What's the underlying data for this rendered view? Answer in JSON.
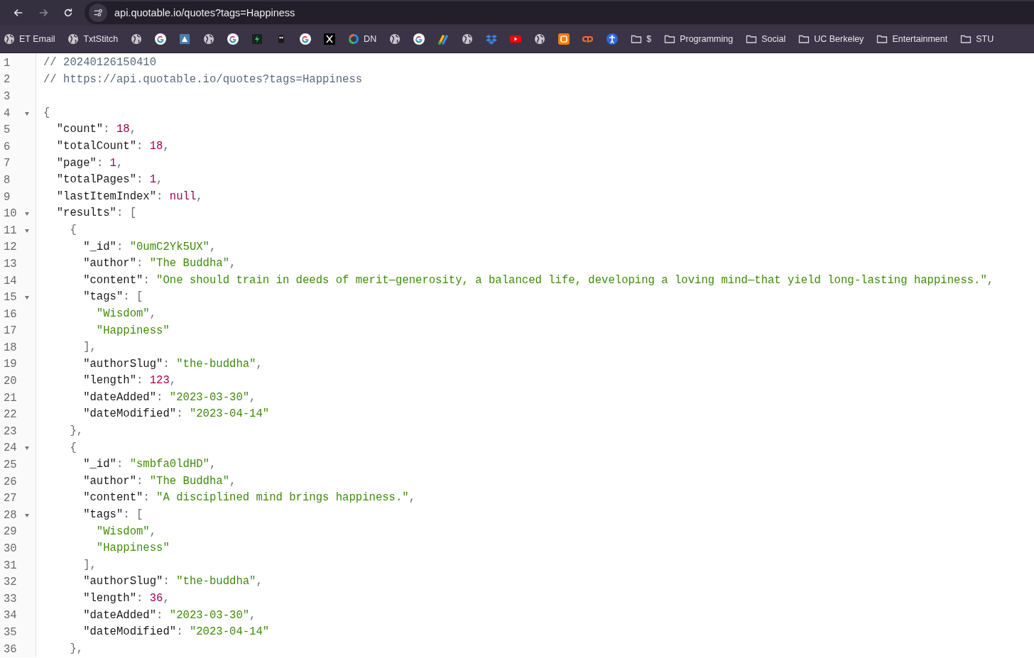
{
  "toolbar": {
    "nav": [
      {
        "kind": "back",
        "disabled": false
      },
      {
        "kind": "forward",
        "disabled": true
      },
      {
        "kind": "reload",
        "disabled": false
      }
    ],
    "url": "api.quotable.io/quotes?tags=Happiness"
  },
  "bookmarks": [
    {
      "kind": "globe",
      "label": "ET Email"
    },
    {
      "kind": "globe",
      "label": "TxtStitch"
    },
    {
      "kind": "globe"
    },
    {
      "kind": "google"
    },
    {
      "kind": "app"
    },
    {
      "kind": "globe"
    },
    {
      "kind": "google"
    },
    {
      "kind": "bolt"
    },
    {
      "kind": "ghost"
    },
    {
      "kind": "google"
    },
    {
      "kind": "x"
    },
    {
      "kind": "ring",
      "label": "DN"
    },
    {
      "kind": "globe"
    },
    {
      "kind": "google"
    },
    {
      "kind": "ads"
    },
    {
      "kind": "globe"
    },
    {
      "kind": "dropbox"
    },
    {
      "kind": "video"
    },
    {
      "kind": "globe"
    },
    {
      "kind": "blogger"
    },
    {
      "kind": "cp"
    },
    {
      "kind": "person"
    },
    {
      "kind": "folder",
      "label": "$"
    },
    {
      "kind": "folder",
      "label": "Programming"
    },
    {
      "kind": "folder",
      "label": "Social"
    },
    {
      "kind": "folder",
      "label": "UC Berkeley"
    },
    {
      "kind": "folder",
      "label": "Entertainment"
    },
    {
      "kind": "folder",
      "label": "STU"
    }
  ],
  "code_lines": [
    {
      "number": "1",
      "foldable": false,
      "tokens": [
        {
          "kind": "comment",
          "text": "// 20240126150410"
        }
      ]
    },
    {
      "number": "2",
      "foldable": false,
      "tokens": [
        {
          "kind": "comment",
          "text": "// https://api.quotable.io/quotes?tags=Happiness"
        }
      ]
    },
    {
      "number": "3",
      "foldable": false
    },
    {
      "number": "4",
      "foldable": true,
      "tokens": [
        {
          "kind": "punct",
          "text": "{"
        }
      ]
    },
    {
      "number": "5",
      "foldable": false,
      "tokens": [
        {
          "kind": "key",
          "text": "  \"count\""
        },
        {
          "kind": "punct",
          "text": ": "
        },
        {
          "kind": "number",
          "text": "18"
        },
        {
          "kind": "punct",
          "text": ","
        }
      ]
    },
    {
      "number": "6",
      "foldable": false,
      "tokens": [
        {
          "kind": "key",
          "text": "  \"totalCount\""
        },
        {
          "kind": "punct",
          "text": ": "
        },
        {
          "kind": "number",
          "text": "18"
        },
        {
          "kind": "punct",
          "text": ","
        }
      ]
    },
    {
      "number": "7",
      "foldable": false,
      "tokens": [
        {
          "kind": "key",
          "text": "  \"page\""
        },
        {
          "kind": "punct",
          "text": ": "
        },
        {
          "kind": "number",
          "text": "1"
        },
        {
          "kind": "punct",
          "text": ","
        }
      ]
    },
    {
      "number": "8",
      "foldable": false,
      "tokens": [
        {
          "kind": "key",
          "text": "  \"totalPages\""
        },
        {
          "kind": "punct",
          "text": ": "
        },
        {
          "kind": "number",
          "text": "1"
        },
        {
          "kind": "punct",
          "text": ","
        }
      ]
    },
    {
      "number": "9",
      "foldable": false,
      "tokens": [
        {
          "kind": "key",
          "text": "  \"lastItemIndex\""
        },
        {
          "kind": "punct",
          "text": ": "
        },
        {
          "kind": "null",
          "text": "null"
        },
        {
          "kind": "punct",
          "text": ","
        }
      ]
    },
    {
      "number": "10",
      "foldable": true,
      "tokens": [
        {
          "kind": "key",
          "text": "  \"results\""
        },
        {
          "kind": "punct",
          "text": ": ["
        }
      ]
    },
    {
      "number": "11",
      "foldable": true,
      "tokens": [
        {
          "kind": "punct",
          "text": "    {"
        }
      ]
    },
    {
      "number": "12",
      "foldable": false,
      "tokens": [
        {
          "kind": "key",
          "text": "      \"_id\""
        },
        {
          "kind": "punct",
          "text": ": "
        },
        {
          "kind": "string",
          "text": "\"0umC2Yk5UX\""
        },
        {
          "kind": "punct",
          "text": ","
        }
      ]
    },
    {
      "number": "13",
      "foldable": false,
      "tokens": [
        {
          "kind": "key",
          "text": "      \"author\""
        },
        {
          "kind": "punct",
          "text": ": "
        },
        {
          "kind": "string",
          "text": "\"The Buddha\""
        },
        {
          "kind": "punct",
          "text": ","
        }
      ]
    },
    {
      "number": "14",
      "foldable": false,
      "tokens": [
        {
          "kind": "key",
          "text": "      \"content\""
        },
        {
          "kind": "punct",
          "text": ": "
        },
        {
          "kind": "string",
          "text": "\"One should train in deeds of merit—generosity, a balanced life, developing a loving mind—that yield long-lasting happiness.\""
        },
        {
          "kind": "punct",
          "text": ","
        }
      ]
    },
    {
      "number": "15",
      "foldable": true,
      "tokens": [
        {
          "kind": "key",
          "text": "      \"tags\""
        },
        {
          "kind": "punct",
          "text": ": ["
        }
      ]
    },
    {
      "number": "16",
      "foldable": false,
      "tokens": [
        {
          "kind": "string",
          "text": "        \"Wisdom\""
        },
        {
          "kind": "punct",
          "text": ","
        }
      ]
    },
    {
      "number": "17",
      "foldable": false,
      "tokens": [
        {
          "kind": "string",
          "text": "        \"Happiness\""
        }
      ]
    },
    {
      "number": "18",
      "foldable": false,
      "tokens": [
        {
          "kind": "punct",
          "text": "      ],"
        }
      ]
    },
    {
      "number": "19",
      "foldable": false,
      "tokens": [
        {
          "kind": "key",
          "text": "      \"authorSlug\""
        },
        {
          "kind": "punct",
          "text": ": "
        },
        {
          "kind": "string",
          "text": "\"the-buddha\""
        },
        {
          "kind": "punct",
          "text": ","
        }
      ]
    },
    {
      "number": "20",
      "foldable": false,
      "tokens": [
        {
          "kind": "key",
          "text": "      \"length\""
        },
        {
          "kind": "punct",
          "text": ": "
        },
        {
          "kind": "number",
          "text": "123"
        },
        {
          "kind": "punct",
          "text": ","
        }
      ]
    },
    {
      "number": "21",
      "foldable": false,
      "tokens": [
        {
          "kind": "key",
          "text": "      \"dateAdded\""
        },
        {
          "kind": "punct",
          "text": ": "
        },
        {
          "kind": "string",
          "text": "\"2023-03-30\""
        },
        {
          "kind": "punct",
          "text": ","
        }
      ]
    },
    {
      "number": "22",
      "foldable": false,
      "tokens": [
        {
          "kind": "key",
          "text": "      \"dateModified\""
        },
        {
          "kind": "punct",
          "text": ": "
        },
        {
          "kind": "string",
          "text": "\"2023-04-14\""
        }
      ]
    },
    {
      "number": "23",
      "foldable": false,
      "tokens": [
        {
          "kind": "punct",
          "text": "    },"
        }
      ]
    },
    {
      "number": "24",
      "foldable": true,
      "tokens": [
        {
          "kind": "punct",
          "text": "    {"
        }
      ]
    },
    {
      "number": "25",
      "foldable": false,
      "tokens": [
        {
          "kind": "key",
          "text": "      \"_id\""
        },
        {
          "kind": "punct",
          "text": ": "
        },
        {
          "kind": "string",
          "text": "\"smbfa0ldHD\""
        },
        {
          "kind": "punct",
          "text": ","
        }
      ]
    },
    {
      "number": "26",
      "foldable": false,
      "tokens": [
        {
          "kind": "key",
          "text": "      \"author\""
        },
        {
          "kind": "punct",
          "text": ": "
        },
        {
          "kind": "string",
          "text": "\"The Buddha\""
        },
        {
          "kind": "punct",
          "text": ","
        }
      ]
    },
    {
      "number": "27",
      "foldable": false,
      "tokens": [
        {
          "kind": "key",
          "text": "      \"content\""
        },
        {
          "kind": "punct",
          "text": ": "
        },
        {
          "kind": "string",
          "text": "\"A disciplined mind brings happiness.\""
        },
        {
          "kind": "punct",
          "text": ","
        }
      ]
    },
    {
      "number": "28",
      "foldable": true,
      "tokens": [
        {
          "kind": "key",
          "text": "      \"tags\""
        },
        {
          "kind": "punct",
          "text": ": ["
        }
      ]
    },
    {
      "number": "29",
      "foldable": false,
      "tokens": [
        {
          "kind": "string",
          "text": "        \"Wisdom\""
        },
        {
          "kind": "punct",
          "text": ","
        }
      ]
    },
    {
      "number": "30",
      "foldable": false,
      "tokens": [
        {
          "kind": "string",
          "text": "        \"Happiness\""
        }
      ]
    },
    {
      "number": "31",
      "foldable": false,
      "tokens": [
        {
          "kind": "punct",
          "text": "      ],"
        }
      ]
    },
    {
      "number": "32",
      "foldable": false,
      "tokens": [
        {
          "kind": "key",
          "text": "      \"authorSlug\""
        },
        {
          "kind": "punct",
          "text": ": "
        },
        {
          "kind": "string",
          "text": "\"the-buddha\""
        },
        {
          "kind": "punct",
          "text": ","
        }
      ]
    },
    {
      "number": "33",
      "foldable": false,
      "tokens": [
        {
          "kind": "key",
          "text": "      \"length\""
        },
        {
          "kind": "punct",
          "text": ": "
        },
        {
          "kind": "number",
          "text": "36"
        },
        {
          "kind": "punct",
          "text": ","
        }
      ]
    },
    {
      "number": "34",
      "foldable": false,
      "tokens": [
        {
          "kind": "key",
          "text": "      \"dateAdded\""
        },
        {
          "kind": "punct",
          "text": ": "
        },
        {
          "kind": "string",
          "text": "\"2023-03-30\""
        },
        {
          "kind": "punct",
          "text": ","
        }
      ]
    },
    {
      "number": "35",
      "foldable": false,
      "tokens": [
        {
          "kind": "key",
          "text": "      \"dateModified\""
        },
        {
          "kind": "punct",
          "text": ": "
        },
        {
          "kind": "string",
          "text": "\"2023-04-14\""
        }
      ]
    },
    {
      "number": "36",
      "foldable": false,
      "tokens": [
        {
          "kind": "punct",
          "text": "    },"
        }
      ]
    }
  ]
}
